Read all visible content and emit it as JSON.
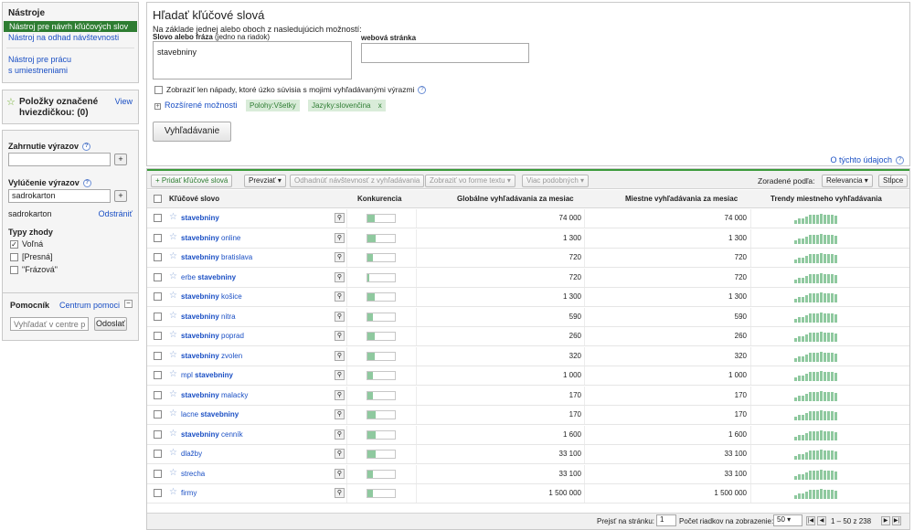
{
  "sidebar": {
    "tools_title": "Nástroje",
    "tools": [
      "Nástroj pre návrh kľúčových slov",
      "Nástroj na odhad návštevnosti",
      "Nástroj pre prácu",
      "s umiestneniami"
    ],
    "starred_title": "Položky označené hviezdičkou: (0)",
    "view_label": "View",
    "include_label": "Zahrnutie výrazov",
    "exclude_label": "Vylúčenie výrazov",
    "exclude_value": "sadrokarton",
    "excluded_term": "sadrokarton",
    "remove_label": "Odstrániť",
    "match_types_label": "Typy zhody",
    "match_types": [
      {
        "label": "Voľná",
        "checked": true
      },
      {
        "label": "[Presná]",
        "checked": false
      },
      {
        "label": "\"Frázová\"",
        "checked": false
      }
    ],
    "helper_title": "Pomocník",
    "help_center": "Centrum pomoci",
    "help_search_placeholder": "Vyhľadať v centre pomoci",
    "send_label": "Odoslať"
  },
  "form": {
    "title": "Hľadať kľúčové slová",
    "subtitle": "Na základe jednej alebo oboch z nasledujúcich možností:",
    "phrase_label": "Slovo alebo fráza",
    "phrase_hint": "(jedno na riadok)",
    "phrase_value": "stavebniny",
    "website_label": "webová stránka",
    "only_related_label": "Zobraziť len nápady, ktoré úzko súvisia s mojimi vyhľadávanými výrazmi",
    "advanced_label": "Rozšírené možnosti",
    "tags": [
      "Polohy:Všetky",
      "Jazyky:slovenčina"
    ],
    "tag_close": "x",
    "search_button": "Vyhľadávanie",
    "about_data": "O týchto údajoch"
  },
  "toolbar": {
    "add_keywords": "+ Pridať kľúčové slová",
    "download": "Prevziať",
    "estimate": "Odhadnúť návštevnosť z vyhľadávania",
    "view_text": "Zobraziť vo forme textu",
    "more_like": "Viac podobných",
    "sorted_by": "Zoradené podľa:",
    "sort_value": "Relevancia",
    "columns": "Stĺpce"
  },
  "table": {
    "headers": {
      "keyword": "Kľúčové slovo",
      "competition": "Konkurencia",
      "global": "Globálne vyhľadávania za mesiac",
      "local": "Miestne vyhľadávania za mesiac",
      "trend": "Trendy miestneho vyhľadávania"
    },
    "rows": [
      {
        "pre": "",
        "bold": "stavebniny",
        "post": "",
        "competition": 0.25,
        "global": "74 000",
        "local": "74 000"
      },
      {
        "pre": "",
        "bold": "stavebniny",
        "post": " online",
        "competition": 0.3,
        "global": "1 300",
        "local": "1 300"
      },
      {
        "pre": "",
        "bold": "stavebniny",
        "post": " bratislava",
        "competition": 0.2,
        "global": "720",
        "local": "720"
      },
      {
        "pre": "erbe ",
        "bold": "stavebniny",
        "post": "",
        "competition": 0.05,
        "global": "720",
        "local": "720"
      },
      {
        "pre": "",
        "bold": "stavebniny",
        "post": " košice",
        "competition": 0.25,
        "global": "1 300",
        "local": "1 300"
      },
      {
        "pre": "",
        "bold": "stavebniny",
        "post": " nitra",
        "competition": 0.2,
        "global": "590",
        "local": "590"
      },
      {
        "pre": "",
        "bold": "stavebniny",
        "post": " poprad",
        "competition": 0.25,
        "global": "260",
        "local": "260"
      },
      {
        "pre": "",
        "bold": "stavebniny",
        "post": " zvolen",
        "competition": 0.25,
        "global": "320",
        "local": "320"
      },
      {
        "pre": "mpl ",
        "bold": "stavebniny",
        "post": "",
        "competition": 0.2,
        "global": "1 000",
        "local": "1 000"
      },
      {
        "pre": "",
        "bold": "stavebniny",
        "post": " malacky",
        "competition": 0.2,
        "global": "170",
        "local": "170"
      },
      {
        "pre": "lacne ",
        "bold": "stavebniny",
        "post": "",
        "competition": 0.3,
        "global": "170",
        "local": "170"
      },
      {
        "pre": "",
        "bold": "stavebniny",
        "post": " cenník",
        "competition": 0.3,
        "global": "1 600",
        "local": "1 600"
      },
      {
        "pre": "dlažby",
        "bold": "",
        "post": "",
        "competition": 0.3,
        "global": "33 100",
        "local": "33 100"
      },
      {
        "pre": "strecha",
        "bold": "",
        "post": "",
        "competition": 0.2,
        "global": "33 100",
        "local": "33 100"
      },
      {
        "pre": "firmy",
        "bold": "",
        "post": "",
        "competition": 0.2,
        "global": "1 500 000",
        "local": "1 500 000"
      }
    ]
  },
  "pagination": {
    "go_to_page": "Prejsť na stránku:",
    "page_value": "1",
    "rows_label": "Počet riadkov na zobrazenie:",
    "rows_value": "50",
    "range": "1 – 50 z 238"
  },
  "colors": {
    "accent": "#2e7d32",
    "bar": "#8fc99f",
    "link": "#1a4fc4"
  }
}
